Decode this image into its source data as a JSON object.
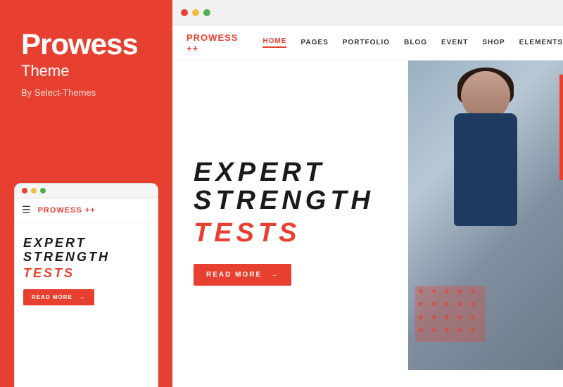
{
  "left_panel": {
    "title": "Prowess",
    "subtitle": "Theme",
    "by_label": "By Select-Themes",
    "mobile_logo": "PROWESS",
    "mobile_logo_suffix": "++",
    "mobile_headline_line1": "EXPERT",
    "mobile_headline_line2": "STRENGTH",
    "mobile_headline_accent": "TESTS",
    "mobile_btn_label": "READ MORE"
  },
  "browser": {
    "dots": [
      "#e84030",
      "#e8b030",
      "#30b030"
    ]
  },
  "site_nav": {
    "logo": "PROWESS",
    "logo_suffix": "++",
    "items": [
      {
        "label": "HOME",
        "active": true
      },
      {
        "label": "PAGES",
        "active": false
      },
      {
        "label": "PORTFOLIO",
        "active": false
      },
      {
        "label": "BLOG",
        "active": false
      },
      {
        "label": "EVENT",
        "active": false
      },
      {
        "label": "SHOP",
        "active": false
      },
      {
        "label": "ELEMENTS",
        "active": false
      }
    ]
  },
  "hero": {
    "headline_line1": "EXPERT",
    "headline_line2": "STRENGTH",
    "headline_accent": "TESTS",
    "btn_label": "READ MORE",
    "btn_arrow": "→"
  },
  "colors": {
    "primary_red": "#e84030",
    "dark": "#1a1a1a"
  }
}
